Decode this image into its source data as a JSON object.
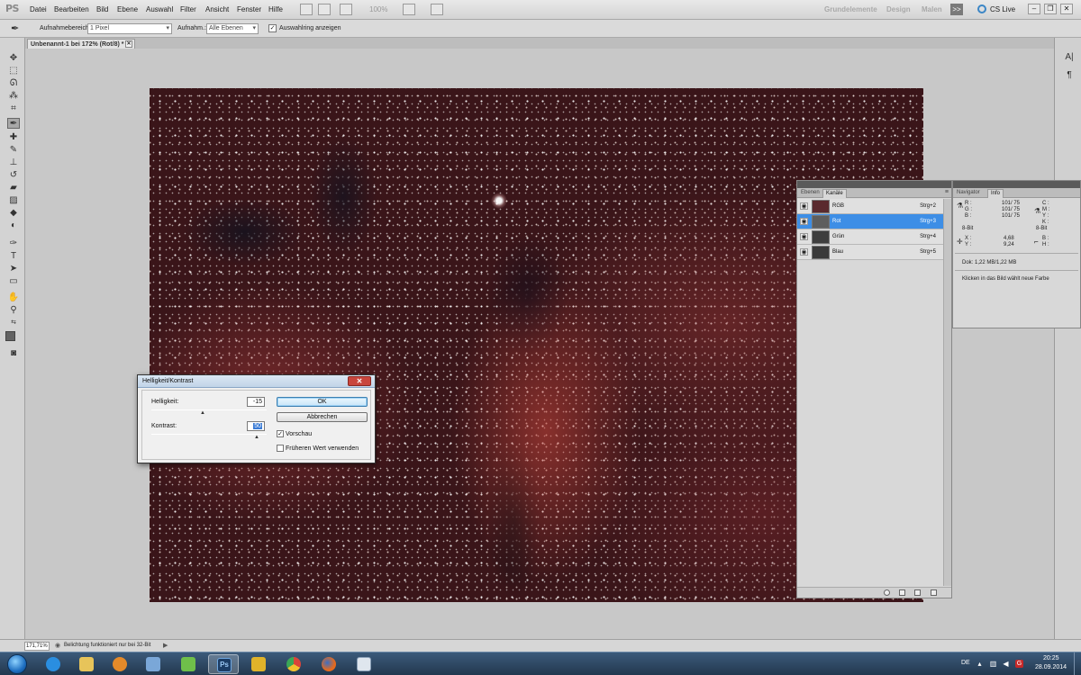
{
  "app": {
    "logo": "PS",
    "menu": [
      "Datei",
      "Bearbeiten",
      "Bild",
      "Ebene",
      "Auswahl",
      "Filter",
      "Ansicht",
      "Fenster",
      "Hilfe"
    ],
    "zoom_display": "100%",
    "workspaces": [
      "Grundelemente",
      "Design",
      "Malen"
    ],
    "more": ">>",
    "cs_live": "CS Live"
  },
  "options_bar": {
    "sample_size_label": "Aufnahmebereich:",
    "sample_size_value": "1 Pixel",
    "sample_label": "Aufnahm.:",
    "sample_value": "Alle Ebenen",
    "show_ring_label": "Auswahlring anzeigen",
    "show_ring_checked": true
  },
  "document": {
    "tab_title": "Unbenannt-1 bei 172% (Rot/8) *"
  },
  "channels_panel": {
    "tabs": [
      "Ebenen",
      "Kanäle"
    ],
    "active_tab": "Kanäle",
    "channels": [
      {
        "name": "RGB",
        "shortcut": "Strg+2",
        "selected": false,
        "thumb_color": "#5a2a2e"
      },
      {
        "name": "Rot",
        "shortcut": "Strg+3",
        "selected": true,
        "thumb_color": "#5e5e5e"
      },
      {
        "name": "Grün",
        "shortcut": "Strg+4",
        "selected": false,
        "thumb_color": "#3e3e3e"
      },
      {
        "name": "Blau",
        "shortcut": "Strg+5",
        "selected": false,
        "thumb_color": "#3a3a3a"
      }
    ]
  },
  "info_panel": {
    "tabs": [
      "Navigator",
      "Info"
    ],
    "active_tab": "Info",
    "rgb_labels": [
      "R :",
      "G :",
      "B :"
    ],
    "rgb_values": [
      "101/ 75",
      "101/ 75",
      "101/ 75"
    ],
    "cmyk_labels": [
      "C :",
      "M :",
      "Y :",
      "K :"
    ],
    "bit_left": "8-Bit",
    "bit_right": "8-Bit",
    "x_label": "X :",
    "y_label": "Y :",
    "x_value": "4,68",
    "y_value": "9,24",
    "b_label": "B :",
    "h_label": "H :",
    "doc_size": "Dok: 1,22 MB/1,22 MB",
    "hint": "Klicken in das Bild wählt neue Farbe"
  },
  "dialog": {
    "title": "Helligkeit/Kontrast",
    "brightness_label": "Helligkeit:",
    "brightness_value": "-15",
    "contrast_label": "Kontrast:",
    "contrast_value": "50",
    "ok_label": "OK",
    "cancel_label": "Abbrechen",
    "preview_label": "Vorschau",
    "preview_checked": true,
    "legacy_label": "Früheren Wert verwenden",
    "legacy_checked": false
  },
  "status_bar": {
    "zoom": "171,71%",
    "message": "Belichtung funktioniert nur bei 32-Bit"
  },
  "taskbar": {
    "apps": [
      {
        "name": "ie",
        "color": "#2a8ee0",
        "active": false
      },
      {
        "name": "explorer",
        "color": "#e7c45a",
        "active": false
      },
      {
        "name": "media-player",
        "color": "#e48a2a",
        "active": false
      },
      {
        "name": "stellarium",
        "color": "#7aa7d8",
        "active": false
      },
      {
        "name": "app-cubes",
        "color": "#6fbf4a",
        "active": false
      },
      {
        "name": "photoshop",
        "color": "#1c3d66",
        "active": true
      },
      {
        "name": "app-yellow",
        "color": "#e0b32a",
        "active": false
      },
      {
        "name": "chrome",
        "color": "#d9453a",
        "active": false
      },
      {
        "name": "firefox",
        "color": "#e56a1e",
        "active": false
      },
      {
        "name": "document-viewer",
        "color": "#dfe6ee",
        "active": false
      }
    ],
    "language": "DE",
    "time": "20:25",
    "date": "28.09.2014"
  }
}
